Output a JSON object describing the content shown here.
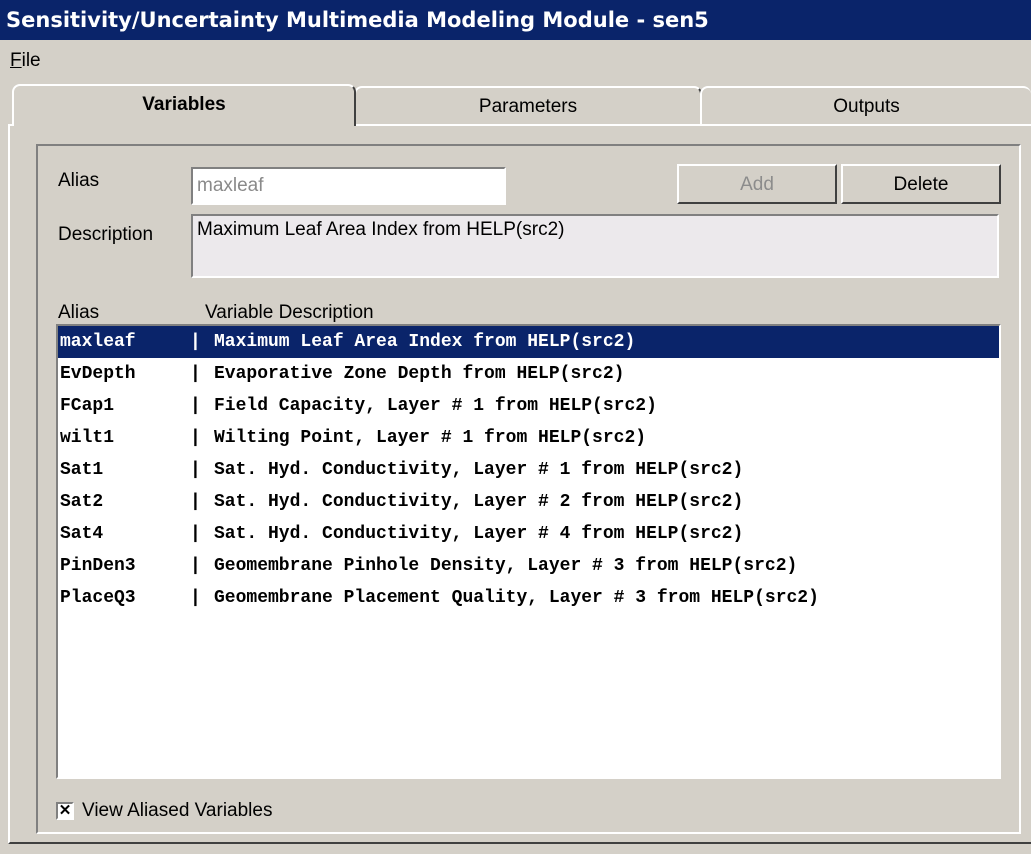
{
  "window": {
    "title": "Sensitivity/Uncertainty Multimedia Modeling Module - sen5"
  },
  "menu": {
    "file_accel": "F",
    "file_rest": "ile"
  },
  "tabs": [
    {
      "label": "Variables",
      "active": true
    },
    {
      "label": "Parameters",
      "active": false
    },
    {
      "label": "Outputs",
      "active": false
    }
  ],
  "form": {
    "alias_label": "Alias",
    "alias_value": "maxleaf",
    "description_label": "Description",
    "description_value": "Maximum Leaf Area Index from HELP(src2)",
    "add_label": "Add",
    "delete_label": "Delete"
  },
  "list": {
    "headers": {
      "alias": "Alias",
      "description": "Variable Description"
    },
    "separator": "|",
    "rows": [
      {
        "alias": "maxleaf",
        "description": "Maximum Leaf Area Index from HELP(src2)",
        "selected": true
      },
      {
        "alias": "EvDepth",
        "description": "Evaporative Zone Depth from HELP(src2)",
        "selected": false
      },
      {
        "alias": "FCap1",
        "description": "Field Capacity, Layer # 1 from HELP(src2)",
        "selected": false
      },
      {
        "alias": "wilt1",
        "description": "Wilting Point, Layer # 1 from HELP(src2)",
        "selected": false
      },
      {
        "alias": "Sat1",
        "description": "Sat. Hyd. Conductivity, Layer # 1 from HELP(src2)",
        "selected": false
      },
      {
        "alias": "Sat2",
        "description": "Sat. Hyd. Conductivity, Layer # 2 from HELP(src2)",
        "selected": false
      },
      {
        "alias": "Sat4",
        "description": "Sat. Hyd. Conductivity, Layer # 4 from HELP(src2)",
        "selected": false
      },
      {
        "alias": "PinDen3",
        "description": "Geomembrane Pinhole Density, Layer # 3 from HELP(src2)",
        "selected": false
      },
      {
        "alias": "PlaceQ3",
        "description": "Geomembrane Placement Quality, Layer # 3 from HELP(src2)",
        "selected": false
      }
    ]
  },
  "checkbox": {
    "label": "View Aliased Variables",
    "checked": true,
    "mark": "✕"
  },
  "colors": {
    "titlebar": "#0a246a",
    "selection": "#0a246a",
    "face": "#d4d0c8"
  }
}
